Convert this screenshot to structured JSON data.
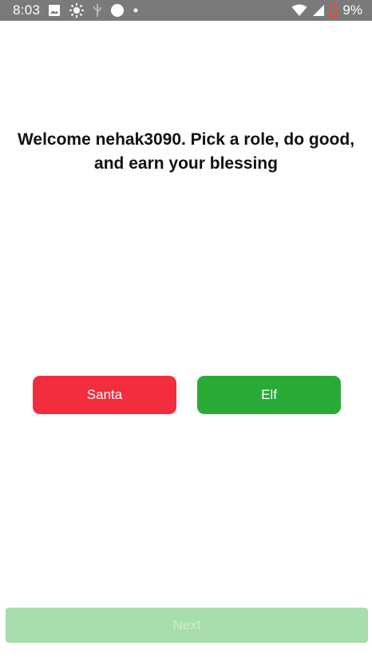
{
  "status_bar": {
    "time": "8:03",
    "battery_percent": "9%",
    "icons": [
      "image-icon",
      "brightness-icon",
      "usb-icon",
      "circle-icon",
      "dot-icon",
      "wifi-icon",
      "signal-icon",
      "battery-low-icon"
    ],
    "background_color": "#7a7a7a"
  },
  "main": {
    "welcome_text": "Welcome nehak3090. Pick a role, do good, and earn your blessing"
  },
  "roles": {
    "santa_label": "Santa",
    "santa_color": "#f22e3e",
    "elf_label": "Elf",
    "elf_color": "#2aab38"
  },
  "footer": {
    "next_label": "Next",
    "next_disabled": true,
    "next_color": "#a8ddae"
  }
}
